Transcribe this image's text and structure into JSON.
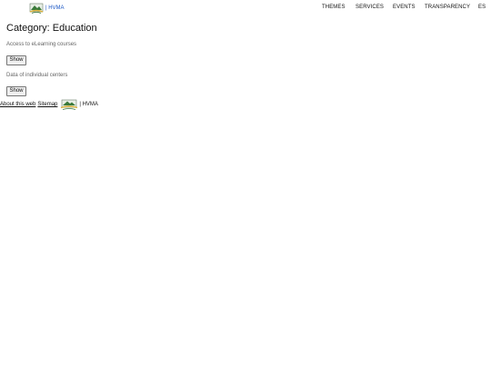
{
  "header": {
    "brand_text": "| HVMA",
    "nav": [
      {
        "label": "THEMES"
      },
      {
        "label": "SERVICES"
      },
      {
        "label": "EVENTS"
      },
      {
        "label": "TRANSPARENCY"
      },
      {
        "label": "ES"
      }
    ]
  },
  "main": {
    "title": "Category: Education",
    "items": [
      {
        "label": "Access to eLearning courses",
        "button": "Show"
      },
      {
        "label": "Data of individual centers",
        "button": "Show"
      }
    ]
  },
  "footer": {
    "about_link": "About this web",
    "sitemap_link": "Sitemap",
    "brand_text": "| HVMA"
  },
  "colors": {
    "link_blue": "#1a56c4",
    "text": "#111111",
    "muted": "#666666",
    "logo_green": "#3a7a3a",
    "logo_gold": "#d9b23a"
  }
}
